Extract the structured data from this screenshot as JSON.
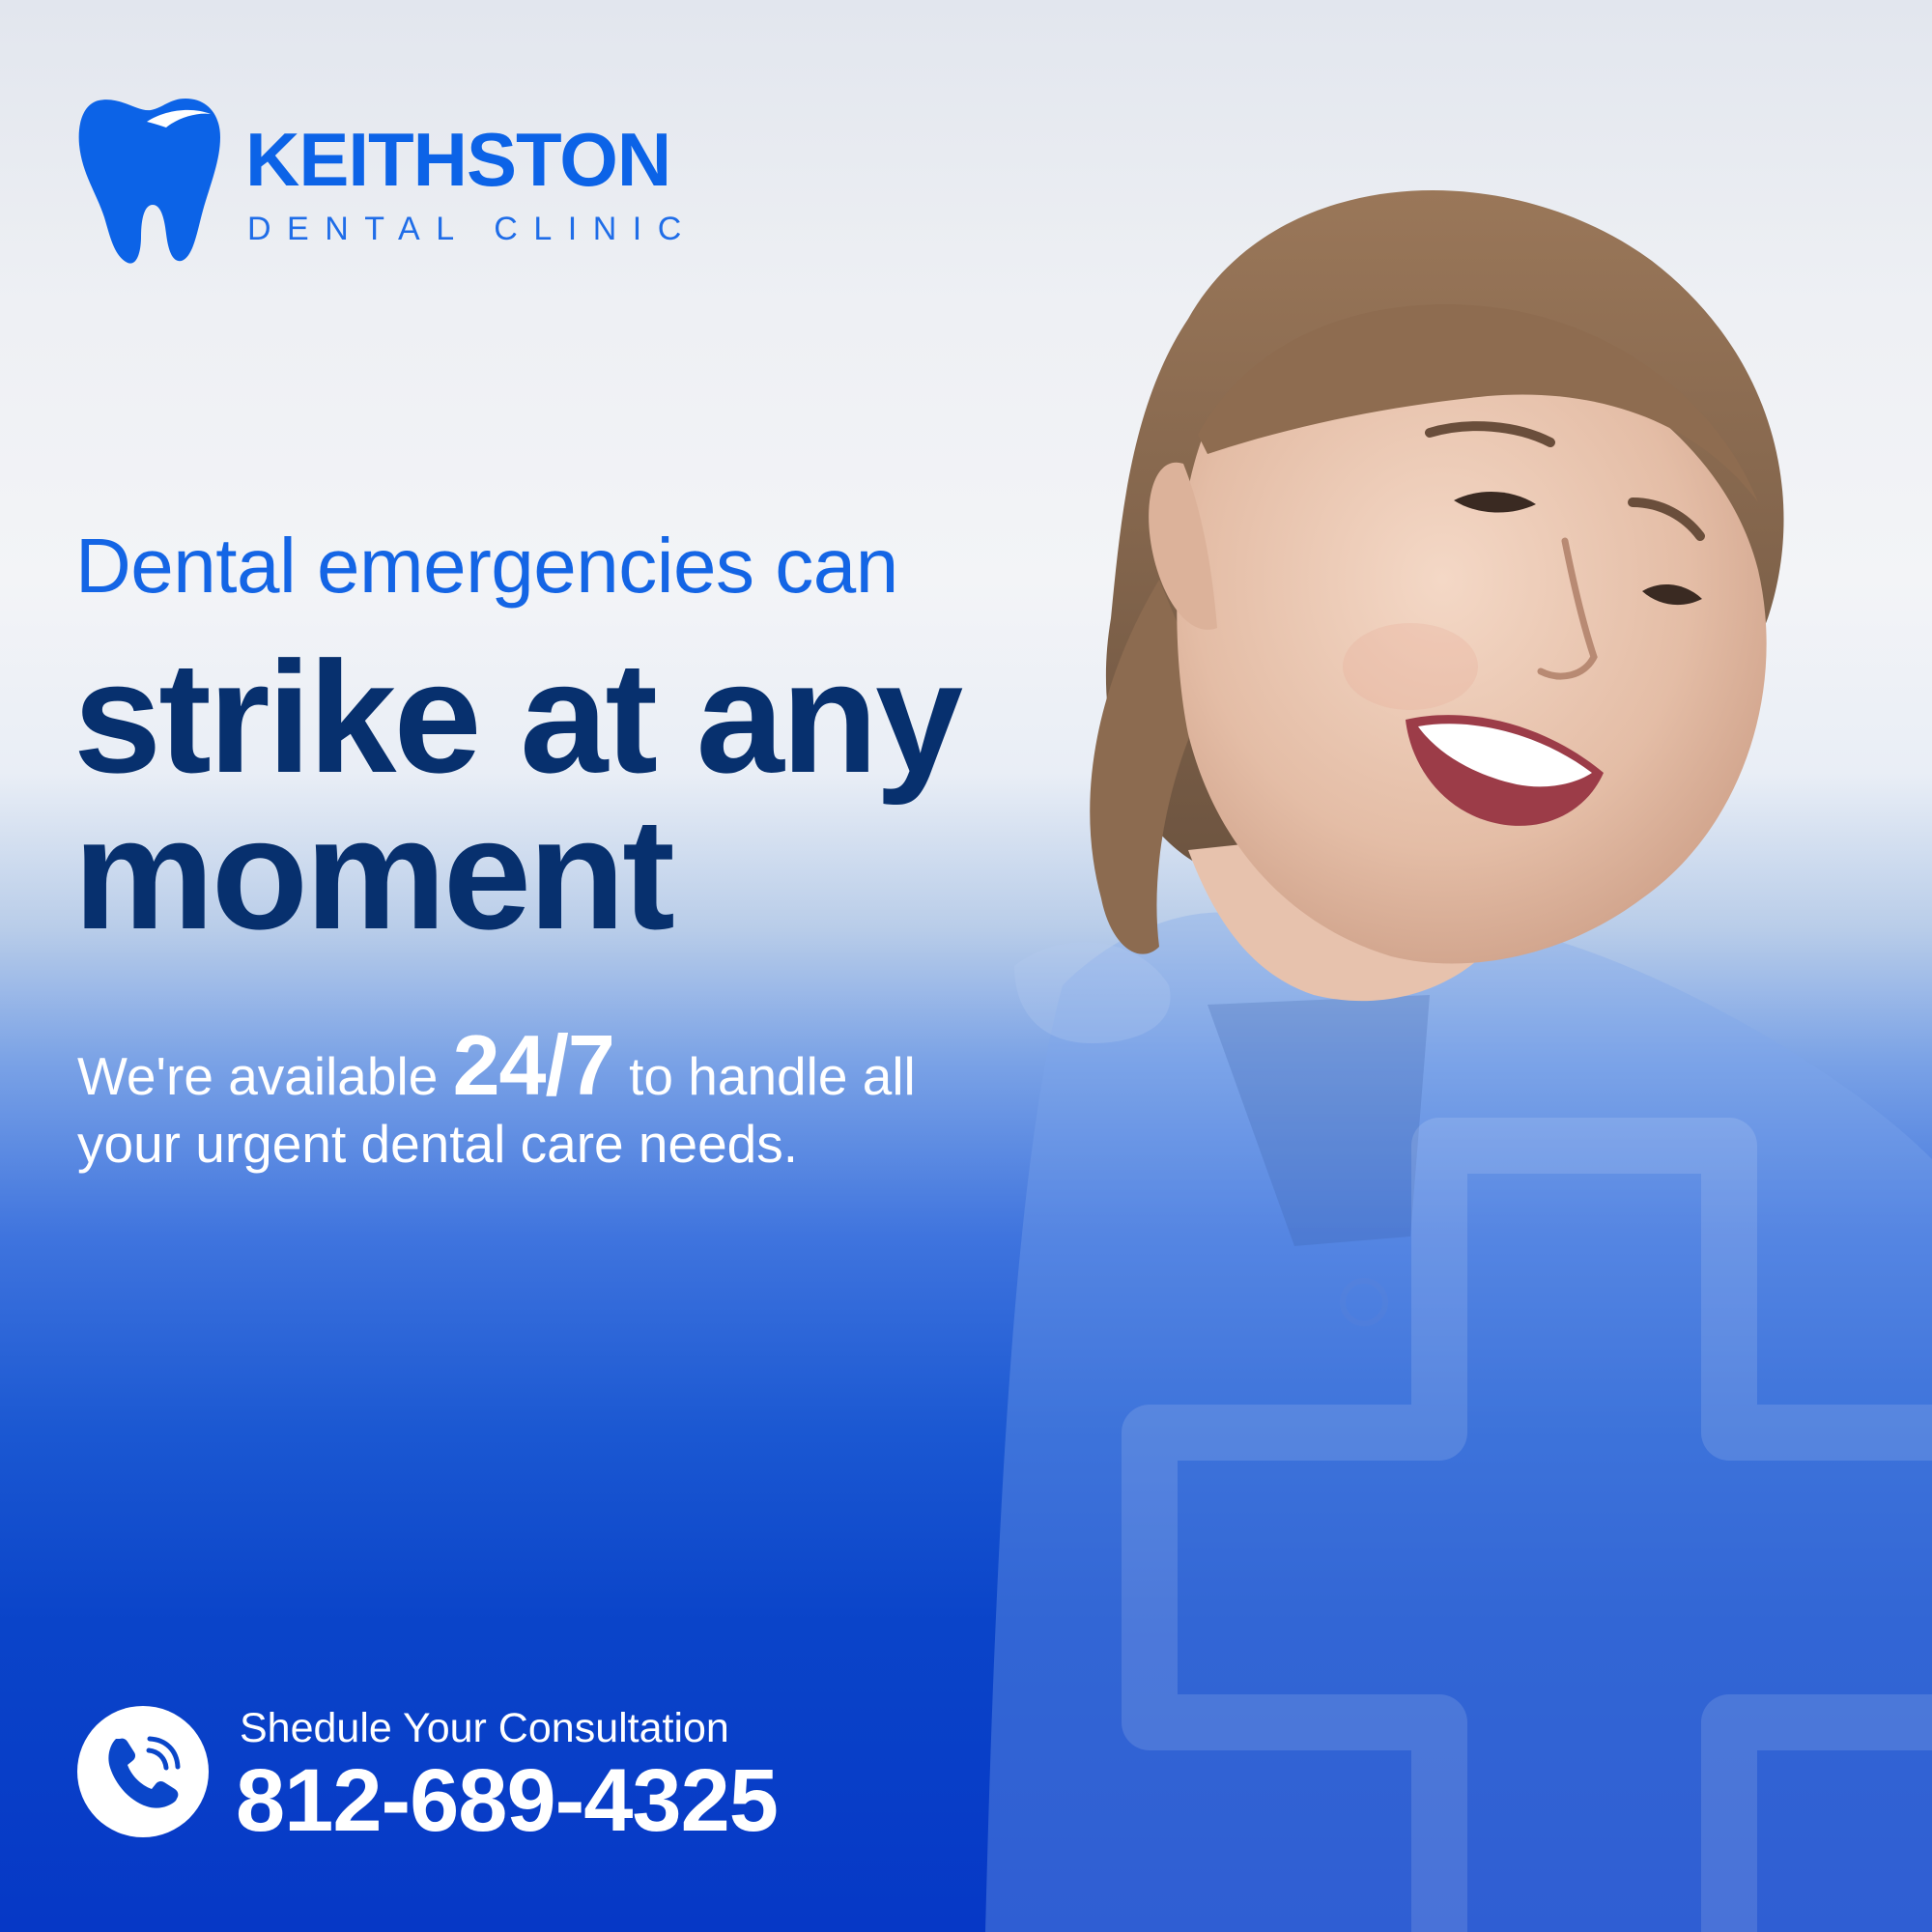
{
  "brand": {
    "name": "KEITHSTON",
    "subtitle": "DENTAL CLINIC",
    "logo_icon": "tooth-icon",
    "color": "#0c63e7"
  },
  "headline": {
    "line1": "Dental emergencies can",
    "line2a": "strike at any",
    "line2b": "moment",
    "accent_color": "#1465e5",
    "dark_color": "#07306e"
  },
  "body": {
    "before": "We're available",
    "highlight": "24/7",
    "after": "to handle all your urgent dental care needs."
  },
  "contact": {
    "icon": "phone-icon",
    "label": "Shedule Your Consultation",
    "phone": "812-689-4325"
  },
  "decor": {
    "watermark_icon": "medical-cross-icon",
    "photo": "smiling-woman-photo"
  },
  "colors": {
    "background_top": "#e2e6ee",
    "background_bottom": "#0638c6"
  }
}
